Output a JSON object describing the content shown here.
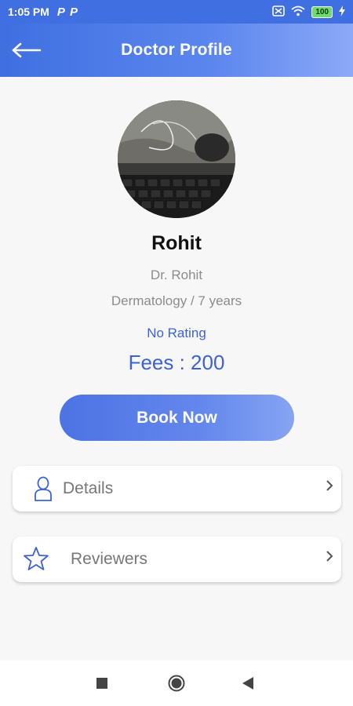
{
  "status_bar": {
    "time": "1:05 PM",
    "app_icons": [
      "P",
      "P"
    ],
    "battery": "100"
  },
  "header": {
    "title": "Doctor Profile"
  },
  "profile": {
    "name": "Rohit",
    "display_name": "Dr. Rohit",
    "specialty_experience": "Dermatology / 7 years",
    "rating": "No Rating",
    "fees": "Fees : 200"
  },
  "actions": {
    "book_label": "Book Now"
  },
  "menu": [
    {
      "label": "Details",
      "icon": "person-icon"
    },
    {
      "label": "Reviewers",
      "icon": "star-icon"
    }
  ],
  "colors": {
    "accent": "#3f6fe0",
    "text_blue": "#3b63d6",
    "muted": "#8c8c8c"
  }
}
